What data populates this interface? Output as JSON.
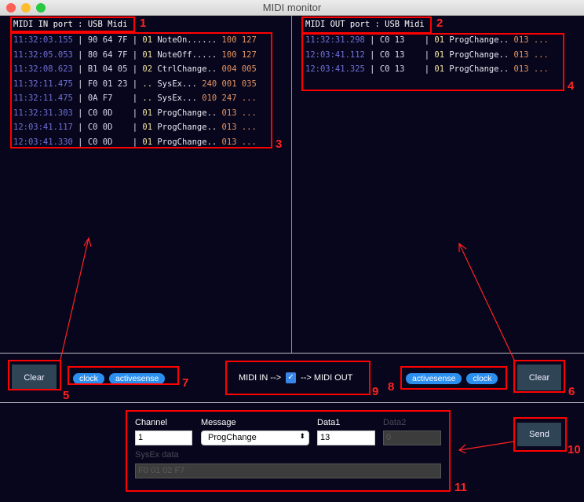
{
  "window": {
    "title": "MIDI monitor"
  },
  "midi_in": {
    "port_label": "MIDI IN port : USB Midi",
    "rows": [
      {
        "time": "11:32:03.155",
        "hex": "90 64 7F",
        "ch": "01",
        "msg": "NoteOn......",
        "vals": "100 127"
      },
      {
        "time": "11:32:05.053",
        "hex": "80 64 7F",
        "ch": "01",
        "msg": "NoteOff.....",
        "vals": "100 127"
      },
      {
        "time": "11:32:08.623",
        "hex": "B1 04 05",
        "ch": "02",
        "msg": "CtrlChange..",
        "vals": "004 005"
      },
      {
        "time": "11:32:11.475",
        "hex": "F0 01 23",
        "ch": "..",
        "msg": "SysEx...",
        "vals": "240 001 035"
      },
      {
        "time": "11:32:11.475",
        "hex": "0A F7   ",
        "ch": "..",
        "msg": "SysEx...",
        "vals": "010 247 ..."
      },
      {
        "time": "11:32:31.303",
        "hex": "C0 0D   ",
        "ch": "01",
        "msg": "ProgChange..",
        "vals": "013 ..."
      },
      {
        "time": "12:03:41.117",
        "hex": "C0 0D   ",
        "ch": "01",
        "msg": "ProgChange..",
        "vals": "013 ..."
      },
      {
        "time": "12:03:41.330",
        "hex": "C0 0D   ",
        "ch": "01",
        "msg": "ProgChange..",
        "vals": "013 ..."
      }
    ],
    "clear_label": "Clear",
    "filters": [
      "clock",
      "activesense"
    ]
  },
  "midi_out": {
    "port_label": "MIDI OUT port : USB Midi",
    "rows": [
      {
        "time": "11:32:31.298",
        "hex": "C0 13   ",
        "ch": "01",
        "msg": "ProgChange..",
        "vals": "013 ..."
      },
      {
        "time": "12:03:41.112",
        "hex": "C0 13   ",
        "ch": "01",
        "msg": "ProgChange..",
        "vals": "013 ..."
      },
      {
        "time": "12:03:41.325",
        "hex": "C0 13   ",
        "ch": "01",
        "msg": "ProgChange..",
        "vals": "013 ..."
      }
    ],
    "clear_label": "Clear",
    "filters": [
      "activesense",
      "clock"
    ]
  },
  "thru": {
    "left": "MIDI IN -->",
    "right": "--> MIDI OUT",
    "checked": true
  },
  "send": {
    "channel_label": "Channel",
    "channel": "1",
    "message_label": "Message",
    "message": "ProgChange",
    "data1_label": "Data1",
    "data1": "13",
    "data2_label": "Data2",
    "data2": "0",
    "sysex_label": "SysEx data",
    "sysex": "F0 01 02 F7",
    "send_label": "Send"
  },
  "annotations": [
    "1",
    "2",
    "3",
    "4",
    "5",
    "6",
    "7",
    "8",
    "9",
    "10",
    "11"
  ]
}
